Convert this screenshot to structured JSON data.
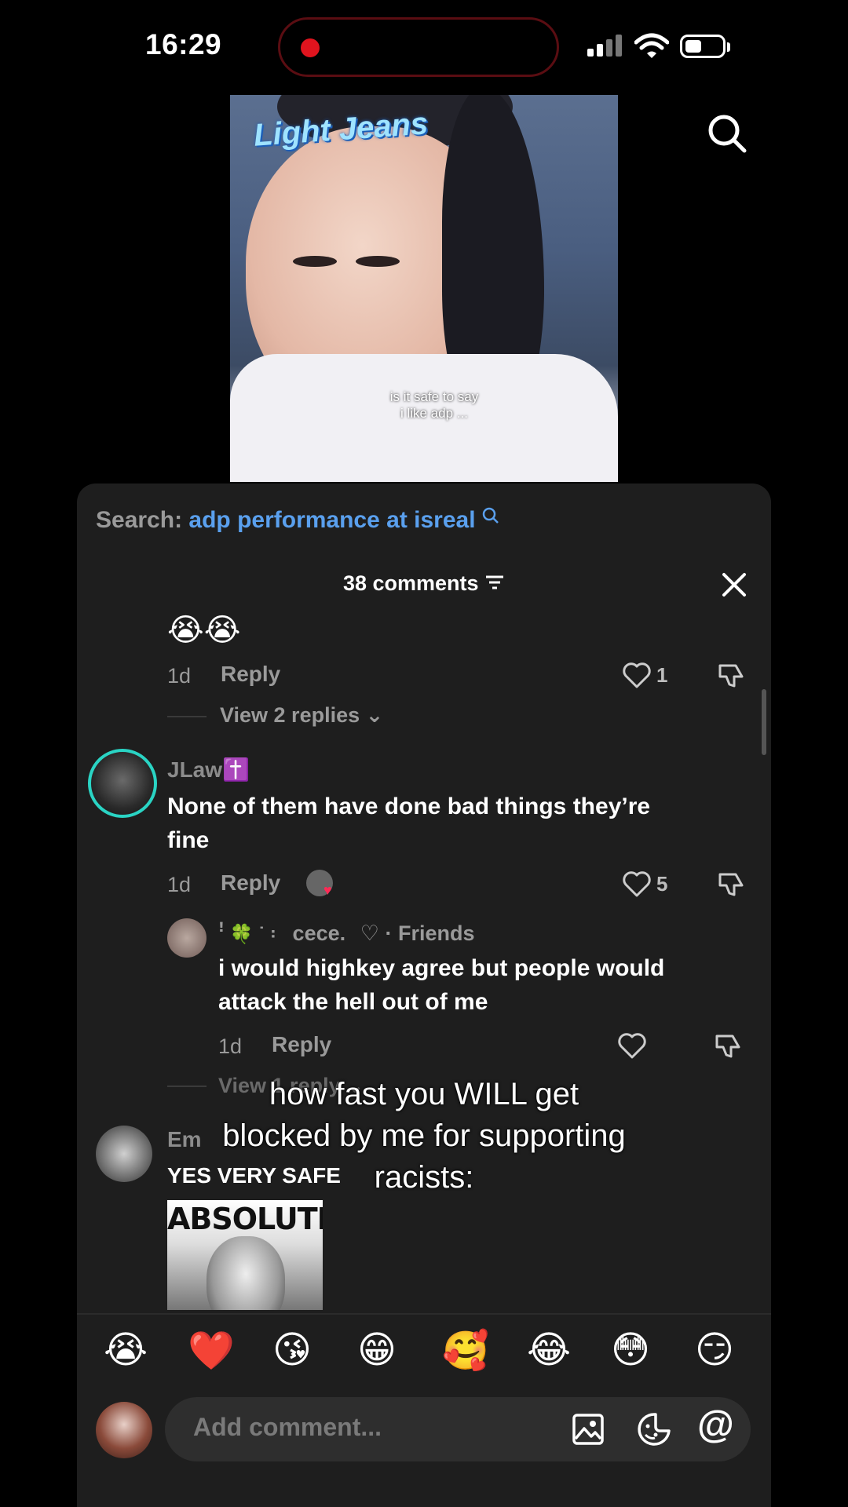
{
  "status_bar": {
    "time": "16:29"
  },
  "video": {
    "logo_text": "Light Jeans",
    "caption_line1": "is it safe to say",
    "caption_line2": "i like adp ..."
  },
  "search": {
    "prefix": "Search:",
    "query": "adp performance at isreal"
  },
  "comments_header": {
    "count_label": "38 comments"
  },
  "comments": {
    "c0": {
      "emoji": "😭😭",
      "age": "1d",
      "reply_label": "Reply",
      "like_count": "1",
      "view_replies": "View 2 replies"
    },
    "c1": {
      "username": "JLaw✝️",
      "text_line1": "None of them have done bad things they’re",
      "text_line2": "fine",
      "age": "1d",
      "reply_label": "Reply",
      "like_count": "5"
    },
    "r1": {
      "username_prefix": "ꜝ 🍀 ˙ ꞉",
      "username": "cece.",
      "friend_tag": "♡ · Friends",
      "text_line1": "i would highkey agree but people would",
      "text_line2": "attack the hell out of me",
      "age": "1d",
      "reply_label": "Reply",
      "view_replies": "View 1 reply"
    },
    "c2": {
      "username": "Em",
      "text": "YES VERY SAFE",
      "meme_title": "ABSOLUTE"
    }
  },
  "overlay_text": {
    "line1": "how fast you WILL get",
    "line2": "blocked by me for supporting",
    "line3": "racists:"
  },
  "emoji_bar": [
    "😭",
    "❤️",
    "😘",
    "😁",
    "🥰",
    "😂",
    "😳",
    "😏"
  ],
  "comment_input": {
    "placeholder": "Add comment..."
  },
  "colors": {
    "accent_link": "#5aa0ee",
    "panel_bg": "#1e1e1e",
    "recording_dot": "#e0141e"
  }
}
